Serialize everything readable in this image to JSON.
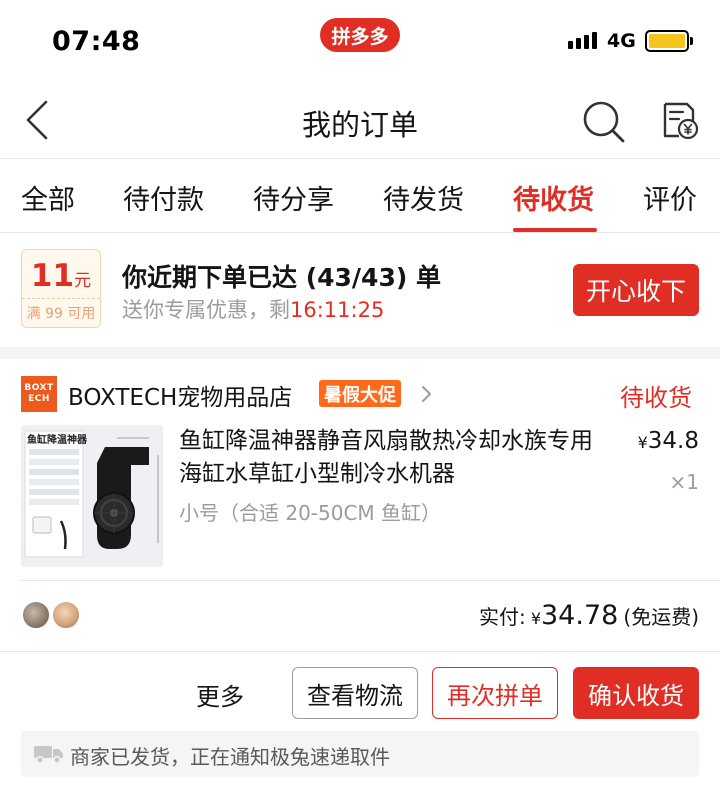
{
  "status_bar": {
    "time": "07:48",
    "brand": "拼多多",
    "network": "4G"
  },
  "nav": {
    "title": "我的订单"
  },
  "tabs": [
    {
      "label": "全部"
    },
    {
      "label": "待付款"
    },
    {
      "label": "待分享"
    },
    {
      "label": "待发货"
    },
    {
      "label": "待收货",
      "active": true
    },
    {
      "label": "评价"
    }
  ],
  "promo": {
    "coupon_amount": "11",
    "coupon_unit": "元",
    "coupon_condition": "满 99 可用",
    "title": "你近期下单已达 (43/43) 单",
    "subtitle": "送你专属优惠，剩",
    "countdown": "16:11:25",
    "button": "开心收下"
  },
  "order": {
    "store_logo_line1": "BOXT",
    "store_logo_line2": "ECH",
    "store_name": "BOXTECH宠物用品店",
    "store_badge": "暑假大促",
    "status": "待收货",
    "product": {
      "image_caption": "鱼缸降温神器",
      "name": "鱼缸降温神器静音风扇散热冷却水族专用海缸水草缸小型制冷水机器",
      "spec": "小号（合适 20-50CM 鱼缸）",
      "currency": "¥",
      "price": "34.8",
      "quantity": "×1"
    },
    "paid_label": "实付:",
    "paid_currency": "¥",
    "paid_amount": "34.78",
    "shipping_note": "(免运费)",
    "actions": {
      "more": "更多",
      "logistics": "查看物流",
      "buy_again": "再次拼单",
      "confirm": "确认收货"
    },
    "notice": "商家已发货，正在通知极兔速递取件"
  },
  "colors": {
    "accent": "#e02e24",
    "badge": "#ff6a1a",
    "logo": "#ee5a1d",
    "gray_text": "#9c9c9c"
  }
}
